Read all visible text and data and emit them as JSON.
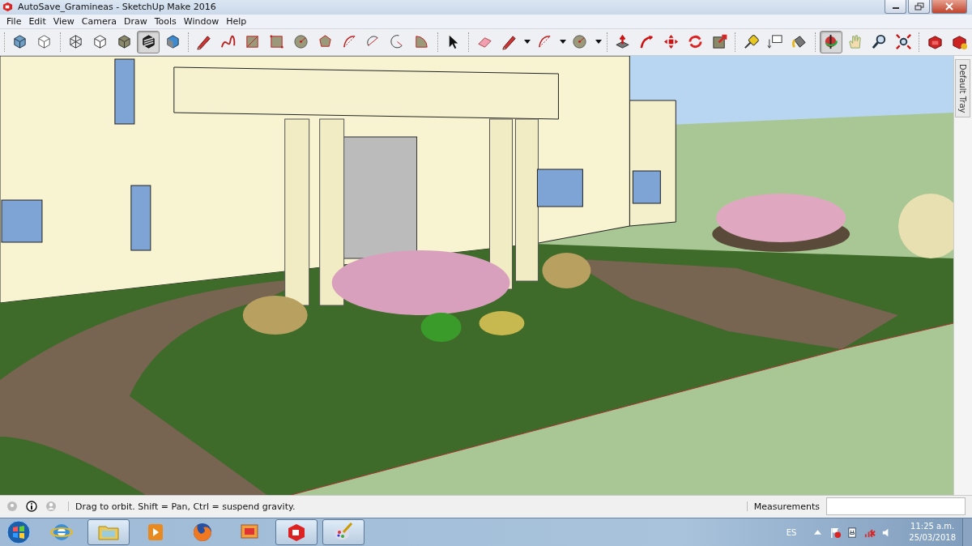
{
  "window": {
    "title": "AutoSave_Gramineas - SketchUp Make 2016"
  },
  "menu": [
    "File",
    "Edit",
    "View",
    "Camera",
    "Draw",
    "Tools",
    "Window",
    "Help"
  ],
  "toolbar": {
    "groups": [
      [
        {
          "kind": "cube-blue",
          "selected": false,
          "dropdown": false
        },
        {
          "kind": "cube-outline",
          "selected": false,
          "dropdown": false
        }
      ],
      [
        {
          "kind": "wireframe",
          "selected": false,
          "dropdown": false
        },
        {
          "kind": "hidden-line",
          "selected": false,
          "dropdown": false
        },
        {
          "kind": "shaded",
          "selected": false,
          "dropdown": false
        },
        {
          "kind": "textured",
          "selected": true,
          "dropdown": false
        },
        {
          "kind": "monochrome",
          "selected": false,
          "dropdown": false
        }
      ],
      [
        {
          "kind": "pencil",
          "selected": false,
          "dropdown": false
        },
        {
          "kind": "freehand",
          "selected": false,
          "dropdown": false
        },
        {
          "kind": "rectangle",
          "selected": false,
          "dropdown": false
        },
        {
          "kind": "rotated-rectangle",
          "selected": false,
          "dropdown": false
        },
        {
          "kind": "circle",
          "selected": false,
          "dropdown": false
        },
        {
          "kind": "polygon",
          "selected": false,
          "dropdown": false
        },
        {
          "kind": "arc",
          "selected": false,
          "dropdown": false
        },
        {
          "kind": "arc2",
          "selected": false,
          "dropdown": false
        },
        {
          "kind": "arc3",
          "selected": false,
          "dropdown": false
        },
        {
          "kind": "pie",
          "selected": false,
          "dropdown": false
        }
      ],
      [
        {
          "kind": "select",
          "selected": false,
          "dropdown": false
        }
      ],
      [
        {
          "kind": "eraser",
          "selected": false,
          "dropdown": false
        },
        {
          "kind": "pencil",
          "selected": false,
          "dropdown": true
        },
        {
          "kind": "arc",
          "selected": false,
          "dropdown": true
        },
        {
          "kind": "circle",
          "selected": false,
          "dropdown": true
        }
      ],
      [
        {
          "kind": "push-pull",
          "selected": false,
          "dropdown": false
        },
        {
          "kind": "follow-me",
          "selected": false,
          "dropdown": false
        },
        {
          "kind": "move",
          "selected": false,
          "dropdown": false
        },
        {
          "kind": "rotate",
          "selected": false,
          "dropdown": false
        },
        {
          "kind": "scale",
          "selected": false,
          "dropdown": false
        }
      ],
      [
        {
          "kind": "tape",
          "selected": false,
          "dropdown": false
        },
        {
          "kind": "text",
          "selected": false,
          "dropdown": false
        },
        {
          "kind": "paint",
          "selected": false,
          "dropdown": false
        }
      ],
      [
        {
          "kind": "orbit",
          "selected": true,
          "dropdown": false
        },
        {
          "kind": "pan",
          "selected": false,
          "dropdown": false
        },
        {
          "kind": "zoom",
          "selected": false,
          "dropdown": false
        },
        {
          "kind": "zoom-extents",
          "selected": false,
          "dropdown": false
        }
      ],
      [
        {
          "kind": "warehouse",
          "selected": false,
          "dropdown": false
        },
        {
          "kind": "extension",
          "selected": false,
          "dropdown": false
        }
      ]
    ]
  },
  "tray_tab": {
    "label": "Default Tray"
  },
  "status_bar": {
    "hint": "Drag to orbit. Shift = Pan, Ctrl = suspend gravity.",
    "measurements_label": "Measurements"
  },
  "taskbar": {
    "apps": [
      {
        "kind": "browser-e",
        "running": false
      },
      {
        "kind": "folder",
        "running": true
      },
      {
        "kind": "media",
        "running": false
      },
      {
        "kind": "fox",
        "running": false
      },
      {
        "kind": "photos",
        "running": false
      },
      {
        "kind": "sketch",
        "running": true
      },
      {
        "kind": "palette",
        "running": true
      }
    ],
    "language": "ES",
    "time": "11:25 a.m.",
    "date": "25/03/2018"
  }
}
